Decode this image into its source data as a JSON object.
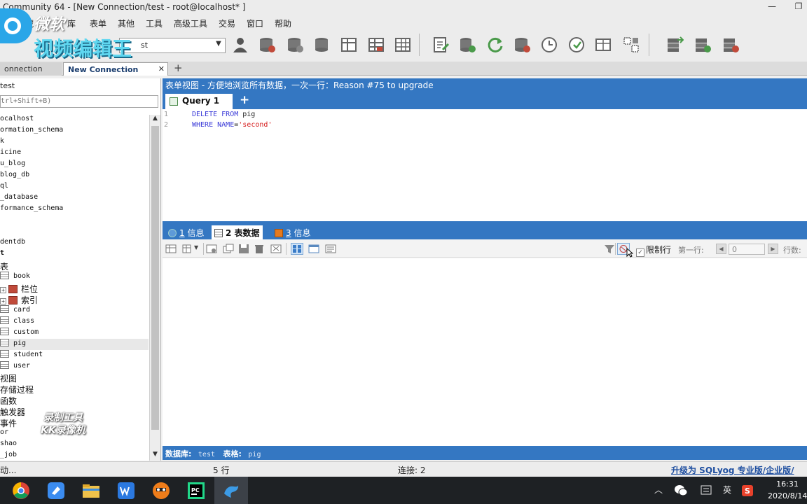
{
  "window": {
    "title": "Community 64 - [New Connection/test - root@localhost* ]",
    "min_icon": "minimize-icon",
    "restore_icon": "restore-icon"
  },
  "menu": [
    "收藏",
    "库",
    "表单",
    "其他",
    "工具",
    "高级工具",
    "交易",
    "窗口",
    "帮助"
  ],
  "toolbar": {
    "connection_value": "st",
    "icons": [
      "user-icon",
      "db-schema-icon",
      "db-icon",
      "db-table-icon",
      "table-design-icon",
      "table-grid-icon",
      "table-import-icon",
      "query-icon",
      "db-sync-icon",
      "refresh-icon",
      "db-backup-icon",
      "schedule-icon",
      "restore-icon",
      "filter-table-icon",
      "compare-icon",
      "server-export-icon",
      "server-sync-icon",
      "server-config-icon"
    ]
  },
  "tabs": {
    "inactive_label": "onnection",
    "active_label": "New Connection",
    "close_glyph": "✕",
    "add_glyph": "+"
  },
  "left": {
    "db_label": "test",
    "filter_placeholder": "trl+Shift+B)",
    "tree": [
      "ocalhost",
      "ormation_schema",
      "k",
      "icine",
      "u_blog",
      "blog_db",
      "ql",
      "_database",
      "formance_schema",
      "",
      "",
      "dentdb",
      "t",
      "表",
      "book",
      "栏位",
      "索引",
      "card",
      "class",
      "custom",
      "pig",
      "student",
      "user",
      "视图",
      "存储过程",
      "函数",
      "触发器",
      "事件",
      "or",
      "shao",
      "_job"
    ]
  },
  "right": {
    "form_bar": "表单视图 - 方便地浏览所有数据，一次一行：Reason #75 to upgrade",
    "query_tab": "Query 1",
    "query_add": "+",
    "editor": {
      "line_numbers": [
        "1",
        "2"
      ],
      "line1": {
        "kw1": "DELETE",
        "kw2": "FROM",
        "rest": " pig"
      },
      "line2": {
        "kw1": "WHERE",
        "kw2": "NAME",
        "eq": "=",
        "str": "'second'"
      }
    },
    "result_tabs": [
      {
        "num": "1",
        "label": "信息"
      },
      {
        "num": "2",
        "label": "表数据"
      },
      {
        "num": "3",
        "label": "信息"
      }
    ],
    "limit_label": "限制行",
    "first_row_label": "第一行:",
    "first_row_value": "0",
    "row_count_label": "行数:",
    "bottom": {
      "db_label": "数据库:",
      "db_value": "test",
      "table_label": "表格:",
      "table_value": "pig"
    }
  },
  "status": {
    "left": "动...",
    "rows": "5 行",
    "connection": "连接: 2",
    "upgrade": "升级为 SQLyog 专业版/企业版/"
  },
  "taskbar": {
    "apps": [
      "chrome-icon",
      "feishu-icon",
      "file-explorer-icon",
      "wps-icon",
      "recorder-icon",
      "pycharm-icon",
      "sqlyog-icon"
    ],
    "tray_lang": "英",
    "time": "16:31",
    "date": "2020/8/14"
  },
  "overlay": {
    "watermark_line1": "微软",
    "watermark_line2": "视频编辑王",
    "recorder_line1": "录制工具",
    "recorder_line2": "KK录像机"
  },
  "colors": {
    "accent": "#3477c2",
    "keyword": "#3b3bd8",
    "string": "#d62020",
    "taskbar": "#1e2124"
  }
}
